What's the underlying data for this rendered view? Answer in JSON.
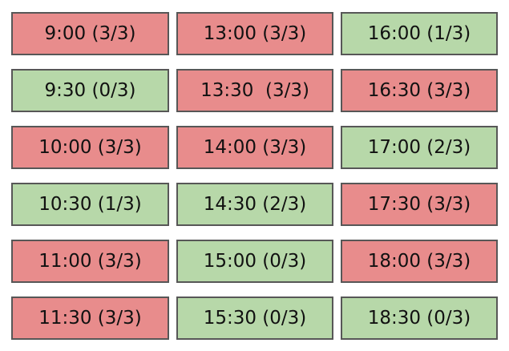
{
  "colors": {
    "full": "#e88c8c",
    "available": "#b7d8a9",
    "border": "#575757"
  },
  "slots": [
    {
      "label": "9:00 (3/3)",
      "status": "full"
    },
    {
      "label": "13:00 (3/3)",
      "status": "full"
    },
    {
      "label": "16:00 (1/3)",
      "status": "available"
    },
    {
      "label": "9:30 (0/3)",
      "status": "available"
    },
    {
      "label": "13:30  (3/3)",
      "status": "full"
    },
    {
      "label": "16:30 (3/3)",
      "status": "full"
    },
    {
      "label": "10:00 (3/3)",
      "status": "full"
    },
    {
      "label": "14:00 (3/3)",
      "status": "full"
    },
    {
      "label": "17:00 (2/3)",
      "status": "available"
    },
    {
      "label": "10:30 (1/3)",
      "status": "available"
    },
    {
      "label": "14:30 (2/3)",
      "status": "available"
    },
    {
      "label": "17:30 (3/3)",
      "status": "full"
    },
    {
      "label": "11:00 (3/3)",
      "status": "full"
    },
    {
      "label": "15:00 (0/3)",
      "status": "available"
    },
    {
      "label": "18:00 (3/3)",
      "status": "full"
    },
    {
      "label": "11:30 (3/3)",
      "status": "full"
    },
    {
      "label": "15:30 (0/3)",
      "status": "available"
    },
    {
      "label": "18:30 (0/3)",
      "status": "available"
    }
  ]
}
